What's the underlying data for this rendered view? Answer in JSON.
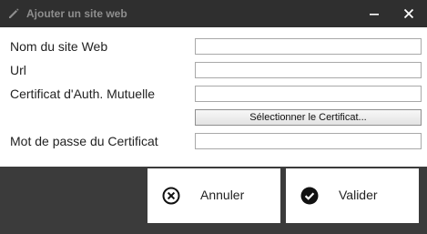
{
  "window": {
    "title": "Ajouter un site web",
    "title_icon": "pencil-icon",
    "minimize_icon": "minimize-icon",
    "close_icon": "close-icon"
  },
  "form": {
    "site_name_label": "Nom du site Web",
    "site_name_value": "",
    "url_label": "Url",
    "url_value": "",
    "cert_label": "Certificat d'Auth. Mutuelle",
    "cert_value": "",
    "select_cert_button": "Sélectionner le Certificat...",
    "cert_password_label": "Mot de passe du Certificat",
    "cert_password_value": ""
  },
  "actions": {
    "cancel_label": "Annuler",
    "cancel_icon": "cancel-circle-icon",
    "validate_label": "Valider",
    "validate_icon": "check-circle-icon"
  },
  "colors": {
    "titlebar": "#2f2f2f",
    "background": "#3b3b3b",
    "panel": "#ffffff"
  }
}
